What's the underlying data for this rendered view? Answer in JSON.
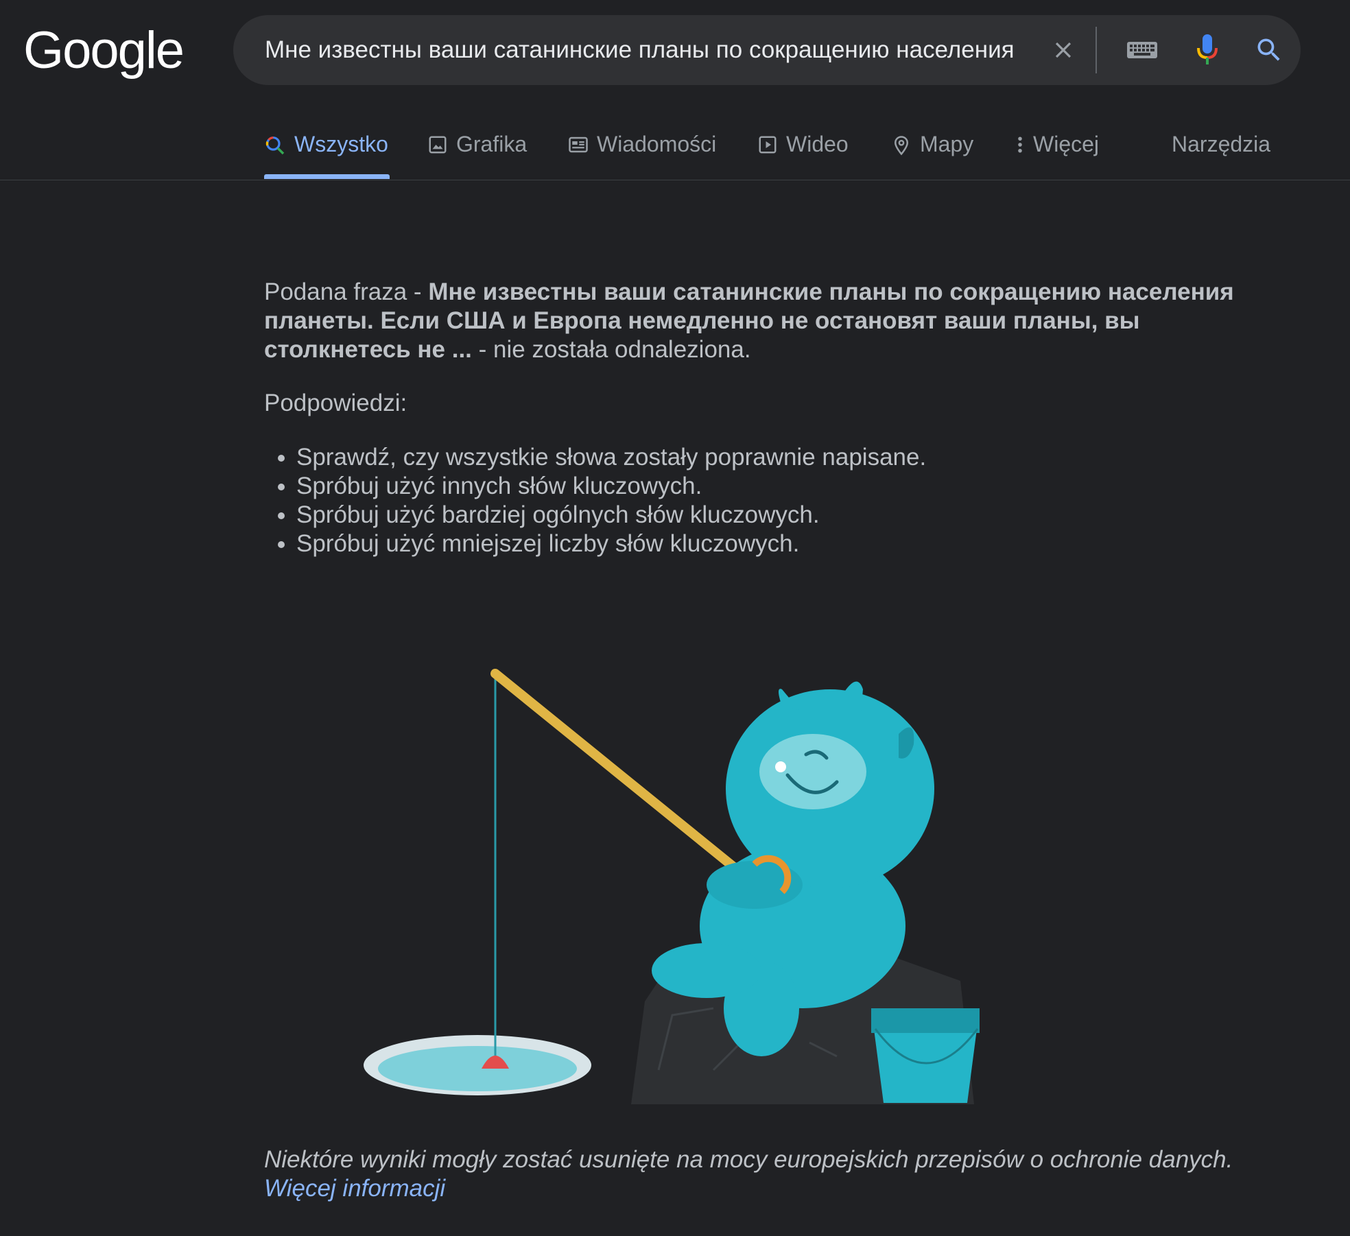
{
  "logo": {
    "text": "Google"
  },
  "search": {
    "query": "Мне известны ваши сатанинские планы по сокращению населения",
    "icons": [
      "close-icon",
      "keyboard-icon",
      "mic-icon",
      "search-icon"
    ]
  },
  "tabs": {
    "all": "Wszystko",
    "images": "Grafika",
    "news": "Wiadomości",
    "video": "Wideo",
    "maps": "Mapy",
    "more": "Więcej",
    "tools": "Narzędzia"
  },
  "message": {
    "prefix": "Podana fraza - ",
    "query_bold": "Мне известны ваши сатанинские планы по сокращению населения планеты. Если США и Европа немедленно не остановят ваши планы, вы столкнетесь не ...",
    "suffix": " - nie została odnaleziona."
  },
  "hints": {
    "title": "Podpowiedzi:",
    "items": [
      "Sprawdź, czy wszystkie słowa zostały poprawnie napisane.",
      "Spróbuj użyć innych słów kluczowych.",
      "Spróbuj użyć bardziej ogólnych słów kluczowych.",
      "Spróbuj użyć mniejszej liczby słów kluczowych."
    ]
  },
  "footer": {
    "notice": "Niektóre wyniki mogły zostać usunięte na mocy europejskich przepisów o ochronie danych.",
    "link": "Więcej informacji"
  },
  "colors": {
    "background": "#202124",
    "accent": "#8ab4f8",
    "text": "#bdc1c6",
    "monster": "#24b5c8",
    "rod": "#e0b545"
  }
}
